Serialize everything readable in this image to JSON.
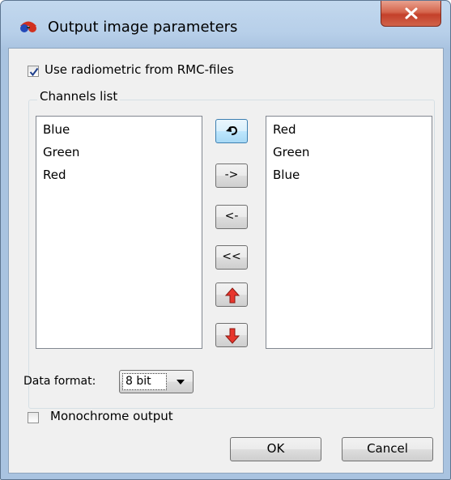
{
  "window": {
    "title": "Output image parameters"
  },
  "options": {
    "use_radiometric_label": "Use radiometric from RMC-files",
    "use_radiometric_checked": true,
    "monochrome_label": "Monochrome output",
    "monochrome_checked": false
  },
  "channels": {
    "group_title": "Channels list",
    "available": [
      "Blue",
      "Green",
      "Red"
    ],
    "selected": [
      "Red",
      "Green",
      "Blue"
    ]
  },
  "buttons": {
    "reset_icon": "undo-arrow-icon",
    "add": "->",
    "remove": "<-",
    "remove_all": "<<",
    "move_up_icon": "red-up-arrow-icon",
    "move_down_icon": "red-down-arrow-icon"
  },
  "data_format": {
    "label": "Data format:",
    "value": "8 bit"
  },
  "dialog": {
    "ok": "OK",
    "cancel": "Cancel"
  },
  "colors": {
    "arrow_red": "#e8362d",
    "titlebar": "#b9d1ea",
    "close_red": "#c7432b"
  }
}
